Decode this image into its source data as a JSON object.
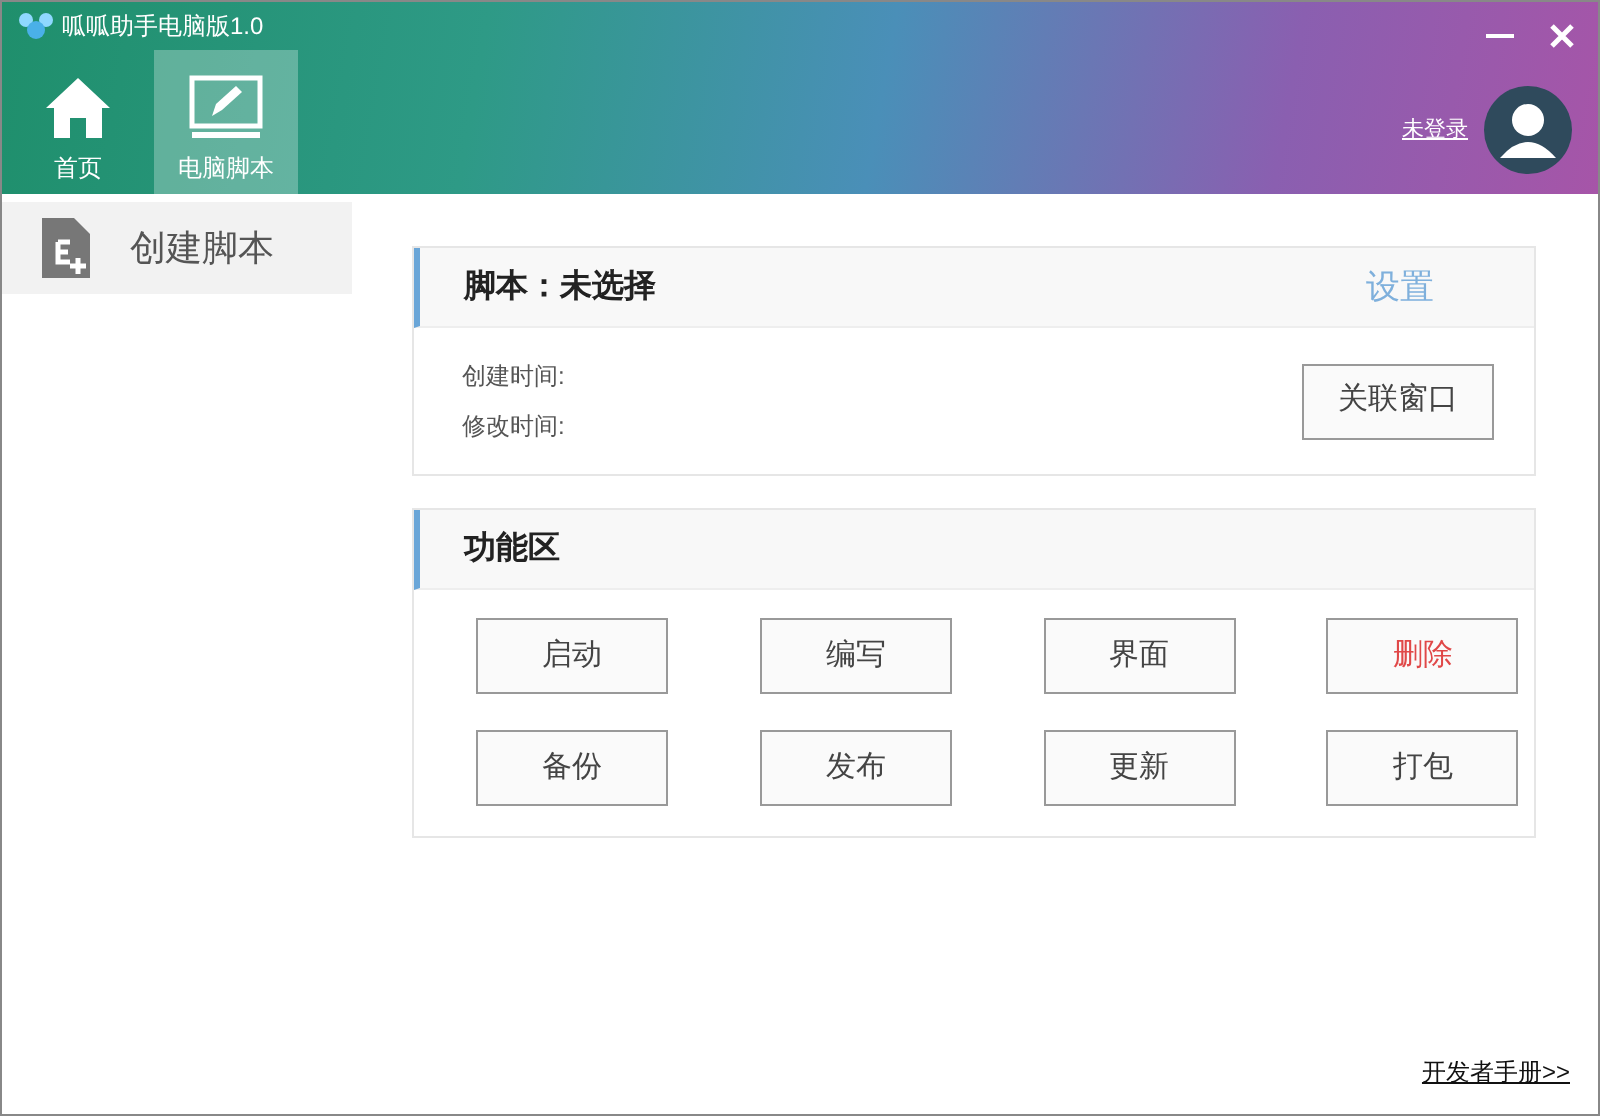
{
  "window": {
    "title": "呱呱助手电脑版1.0"
  },
  "tabs": [
    {
      "label": "首页",
      "selected": false
    },
    {
      "label": "电脑脚本",
      "selected": true
    }
  ],
  "user": {
    "name": "未登录"
  },
  "sidebar": {
    "items": [
      {
        "label": "创建脚本"
      }
    ]
  },
  "script_card": {
    "title": "脚本：未选择",
    "settings_link": "设置",
    "fields": [
      "创建时间:",
      "修改时间:"
    ],
    "button": "关联窗口"
  },
  "functions_card": {
    "title": "功能区",
    "buttons": [
      {
        "label": "启动",
        "kind": "normal"
      },
      {
        "label": "编写",
        "kind": "normal"
      },
      {
        "label": "界面",
        "kind": "normal"
      },
      {
        "label": "删除",
        "kind": "danger"
      },
      {
        "label": "备份",
        "kind": "normal"
      },
      {
        "label": "发布",
        "kind": "normal"
      },
      {
        "label": "更新",
        "kind": "normal"
      },
      {
        "label": "打包",
        "kind": "normal"
      }
    ]
  },
  "footer_link": "开发者手册>>"
}
